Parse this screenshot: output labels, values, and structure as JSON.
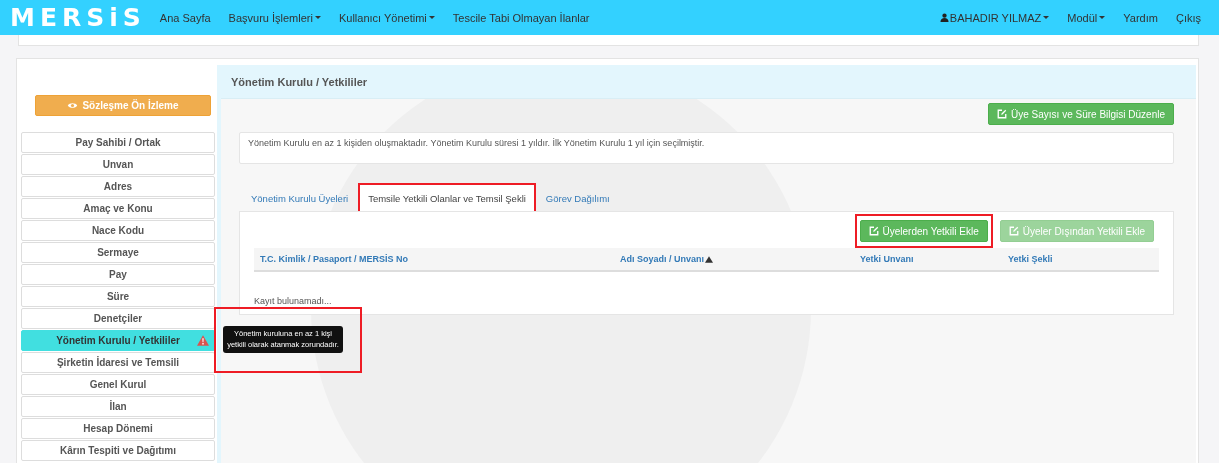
{
  "navbar": {
    "logo": "MERSiS",
    "left_items": [
      {
        "label": "Ana Sayfa",
        "dropdown": false
      },
      {
        "label": "Başvuru İşlemleri",
        "dropdown": true
      },
      {
        "label": "Kullanıcı Yönetimi",
        "dropdown": true
      },
      {
        "label": "Tescile Tabi Olmayan İlanlar",
        "dropdown": false
      }
    ],
    "right_items": [
      {
        "label": "BAHADIR YILMAZ",
        "dropdown": true,
        "kind": "user"
      },
      {
        "label": "Modül",
        "dropdown": true,
        "kind": "link"
      },
      {
        "label": "Yardım",
        "dropdown": false,
        "kind": "link"
      },
      {
        "label": "Çıkış",
        "dropdown": false,
        "kind": "link"
      }
    ]
  },
  "sidebar": {
    "preview_button": "Sözleşme Ön İzleme",
    "items": [
      {
        "label": "Pay Sahibi / Ortak",
        "selected": false,
        "warning": false
      },
      {
        "label": "Unvan",
        "selected": false,
        "warning": false
      },
      {
        "label": "Adres",
        "selected": false,
        "warning": false
      },
      {
        "label": "Amaç ve Konu",
        "selected": false,
        "warning": false
      },
      {
        "label": "Nace Kodu",
        "selected": false,
        "warning": false
      },
      {
        "label": "Sermaye",
        "selected": false,
        "warning": false
      },
      {
        "label": "Pay",
        "selected": false,
        "warning": false
      },
      {
        "label": "Süre",
        "selected": false,
        "warning": false
      },
      {
        "label": "Denetçiler",
        "selected": false,
        "warning": false
      },
      {
        "label": "Yönetim Kurulu / Yetkililer",
        "selected": true,
        "warning": true
      },
      {
        "label": "Şirketin İdaresi ve Temsili",
        "selected": false,
        "warning": false
      },
      {
        "label": "Genel Kurul",
        "selected": false,
        "warning": false
      },
      {
        "label": "İlan",
        "selected": false,
        "warning": false
      },
      {
        "label": "Hesap Dönemi",
        "selected": false,
        "warning": false
      },
      {
        "label": "Kârın Tespiti ve Dağıtımı",
        "selected": false,
        "warning": false
      }
    ]
  },
  "tooltip": {
    "text": "Yönetim kuruluna en az 1 kişi yetkili olarak atanmak zorundadır.",
    "highlighted": true
  },
  "panel": {
    "title": "Yönetim Kurulu / Yetkililer",
    "edit_button": "Üye Sayısı ve Süre Bilgisi Düzenle",
    "info": "Yönetim Kurulu en az 1 kişiden oluşmaktadır. Yönetim Kurulu süresi 1 yıldır. İlk Yönetim Kurulu 1 yıl için seçilmiştir.",
    "tabs": [
      {
        "label": "Yönetim Kurulu Üyeleri",
        "selected": false,
        "highlighted": false
      },
      {
        "label": "Temsile Yetkili Olanlar ve Temsil Şekli",
        "selected": true,
        "highlighted": true
      },
      {
        "label": "Görev Dağılımı",
        "selected": false,
        "highlighted": false
      }
    ],
    "actions": [
      {
        "label": "Üyelerden Yetkili Ekle",
        "disabled": false,
        "highlighted": true
      },
      {
        "label": "Üyeler Dışından Yetkili Ekle",
        "disabled": true,
        "highlighted": false
      }
    ],
    "table": {
      "columns": [
        {
          "label": "T.C. Kimlik / Pasaport / MERSİS No",
          "sorted": false
        },
        {
          "label": "Adı Soyadı / Unvanı",
          "sorted": true
        },
        {
          "label": "Yetki Unvanı",
          "sorted": false
        },
        {
          "label": "Yetki Şekli",
          "sorted": false
        }
      ],
      "empty_text": "Kayıt bulunamadı..."
    }
  }
}
